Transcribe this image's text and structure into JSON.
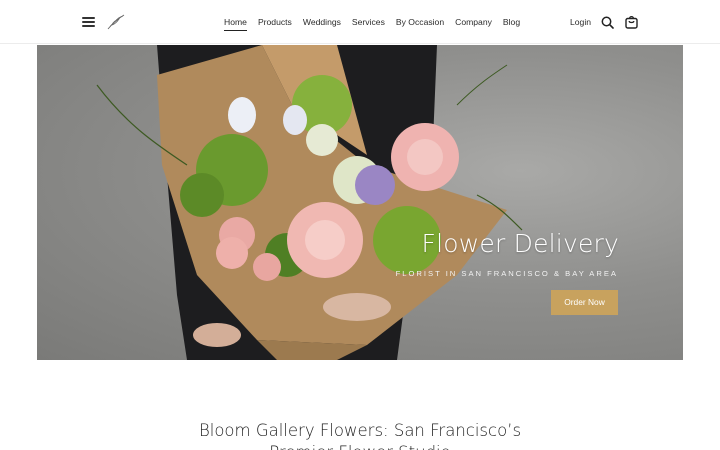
{
  "header": {
    "menu_icon": "hamburger-menu-icon",
    "logo_icon": "leaf-logo-icon",
    "nav": [
      {
        "label": "Home",
        "active": true
      },
      {
        "label": "Products",
        "active": false
      },
      {
        "label": "Weddings",
        "active": false
      },
      {
        "label": "Services",
        "active": false
      },
      {
        "label": "By Occasion",
        "active": false
      },
      {
        "label": "Company",
        "active": false
      },
      {
        "label": "Blog",
        "active": false
      }
    ],
    "login_label": "Login",
    "search_icon": "search-icon",
    "cart_icon": "shopping-bag-icon"
  },
  "hero": {
    "title": "Flower Delivery",
    "subtitle": "FLORIST IN SAN FRANCISCO & BAY AREA",
    "cta_label": "Order Now",
    "cta_color": "#c8a25e"
  },
  "section": {
    "title": "Bloom Gallery Flowers: San Francisco’s Premier Flower Studio"
  }
}
